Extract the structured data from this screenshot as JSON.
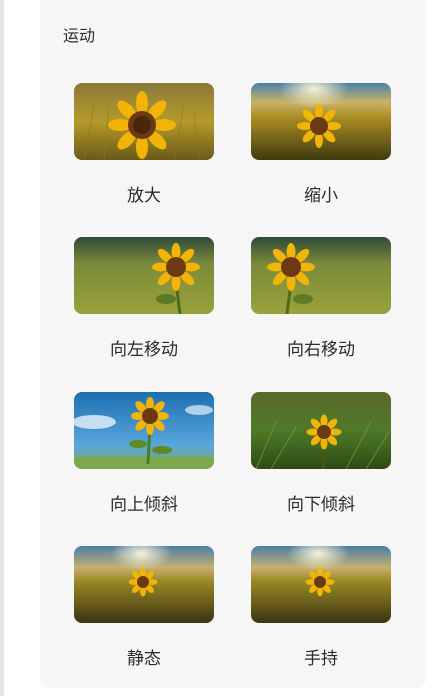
{
  "section": {
    "title": "运动"
  },
  "effects": [
    {
      "label": "放大"
    },
    {
      "label": "缩小"
    },
    {
      "label": "向左移动"
    },
    {
      "label": "向右移动"
    },
    {
      "label": "向上倾斜"
    },
    {
      "label": "向下倾斜"
    },
    {
      "label": "静态"
    },
    {
      "label": "手持"
    }
  ],
  "colors": {
    "panel_bg": "#f6f6f7",
    "petal": "#f2b409",
    "center": "#6b3a12",
    "field": "#b59a2a",
    "sky": "#4a7fa8"
  }
}
